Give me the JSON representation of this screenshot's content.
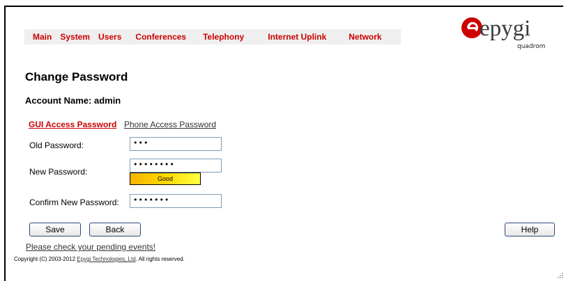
{
  "nav": {
    "items": [
      {
        "label": "Main"
      },
      {
        "label": "System"
      },
      {
        "label": "Users"
      },
      {
        "label": "Conferences"
      },
      {
        "label": "Telephony"
      },
      {
        "label": "Internet Uplink"
      },
      {
        "label": "Network"
      }
    ]
  },
  "brand": {
    "name": "epygi",
    "product": "quadrom",
    "accent": "#cc0000"
  },
  "page": {
    "title": "Change Password",
    "account_line": "Account Name: admin"
  },
  "tabs": {
    "gui": "GUI Access Password",
    "phone": "Phone Access Password"
  },
  "form": {
    "old_label": "Old Password:",
    "old_value": "•••",
    "new_label": "New Password:",
    "new_value": "••••••••",
    "strength": "Good",
    "confirm_label": "Confirm New Password:",
    "confirm_value": "•••••••"
  },
  "buttons": {
    "save": "Save",
    "back": "Back",
    "help": "Help"
  },
  "footer": {
    "pending": "Please check your pending events!",
    "copyright_prefix": "Copyright (C) 2003-2012 ",
    "company": "Epygi Technologies, Ltd",
    "copyright_suffix": ". All rights reserved."
  }
}
